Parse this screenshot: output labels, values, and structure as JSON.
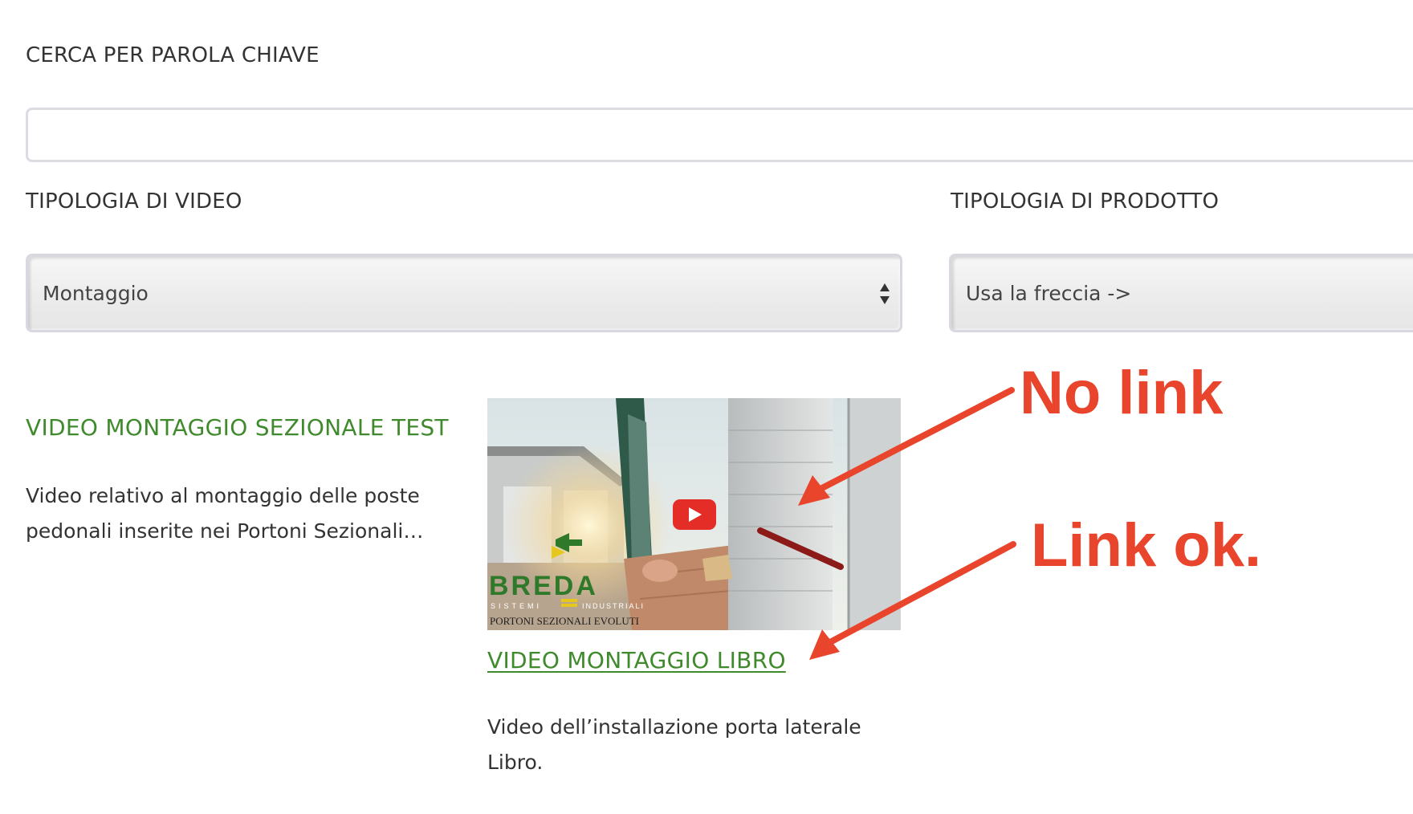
{
  "filters": {
    "keyword_label": "CERCA PER PAROLA CHIAVE",
    "keyword_value": "",
    "video_type_label": "TIPOLOGIA DI VIDEO",
    "video_type_selected": "Montaggio",
    "product_type_label": "TIPOLOGIA DI PRODOTTO",
    "product_type_selected": "Usa la freccia ->"
  },
  "results": [
    {
      "title": "VIDEO MONTAGGIO SEZIONALE TEST",
      "description": "Video relativo al montaggio delle poste pedonali inserite nei Portoni Sezionali…",
      "linked": false
    },
    {
      "title": "VIDEO MONTAGGIO LIBRO",
      "description": "Video dell’installazione porta laterale Libro.",
      "linked": true,
      "thumbnail": {
        "brand": "BREDA",
        "brand_sub_left": "SISTEMI",
        "brand_sub_right": "INDUSTRIALI",
        "tagline": "PORTONI SEZIONALI EVOLUTI",
        "play_icon": "youtube-play-icon"
      }
    }
  ],
  "annotations": {
    "no_link": "No link",
    "link_ok": "Link ok.",
    "color": "#e8452c"
  },
  "colors": {
    "link_green": "#3f8a2c",
    "text": "#333333",
    "border": "#dcdce3"
  }
}
